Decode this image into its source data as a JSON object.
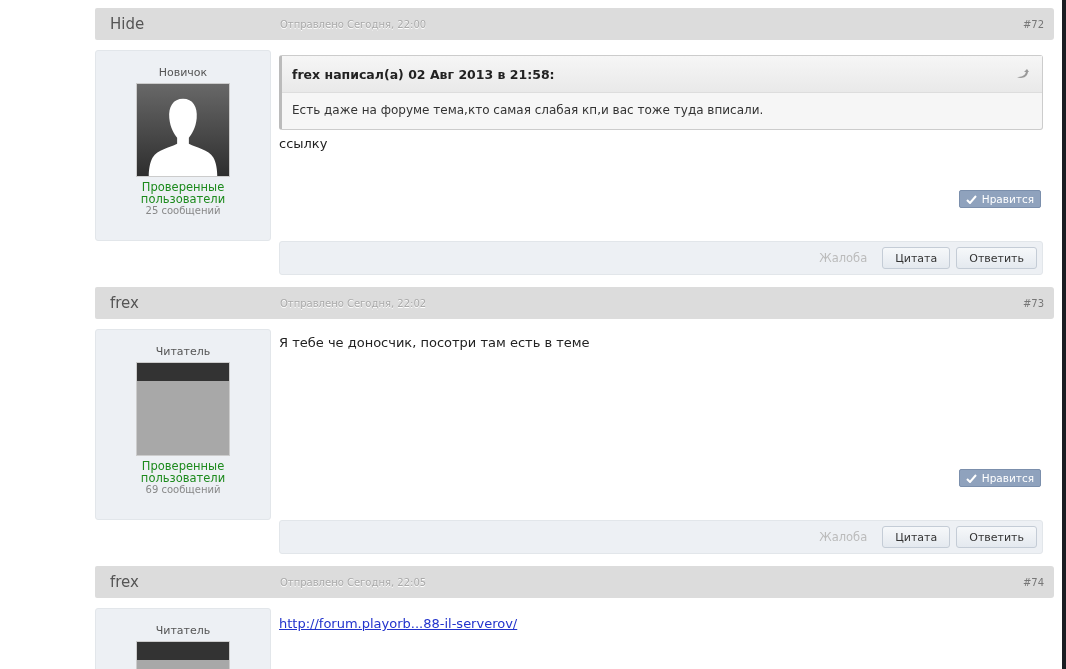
{
  "posts": [
    {
      "author": "Hide",
      "sent": "Отправлено Сегодня, 22:00",
      "number": "#72",
      "rank": "Новичок",
      "avatar": {
        "kind": "silhouette"
      },
      "group": "Проверенные пользователи",
      "post_count": "25 сообщений",
      "quote": {
        "header": "frex написал(а) 02 Авг 2013 в 21:58:",
        "text": "Есть даже на форуме тема,кто самая слабая кп,и вас тоже туда вписали."
      },
      "body": [
        {
          "kind": "text",
          "text": "ссылку"
        }
      ],
      "like": "Нравится",
      "report": "Жалоба",
      "quote_button": "Цитата",
      "reply_button": "Ответить"
    },
    {
      "author": "frex",
      "sent": "Отправлено Сегодня, 22:02",
      "number": "#73",
      "rank": "Читатель",
      "avatar": {
        "kind": "photo"
      },
      "group": "Проверенные пользователи",
      "post_count": "69 сообщений",
      "body": [
        {
          "kind": "text",
          "text": "Я тебе че доносчик, посотри там есть в теме"
        }
      ],
      "like": "Нравится",
      "report": "Жалоба",
      "quote_button": "Цитата",
      "reply_button": "Ответить"
    },
    {
      "author": "frex",
      "sent": "Отправлено Сегодня, 22:05",
      "number": "#74",
      "rank": "Читатель",
      "avatar": {
        "kind": "photo"
      },
      "body": [
        {
          "kind": "link",
          "text": "http://forum.playorb...88-il-serverov/"
        }
      ]
    }
  ]
}
